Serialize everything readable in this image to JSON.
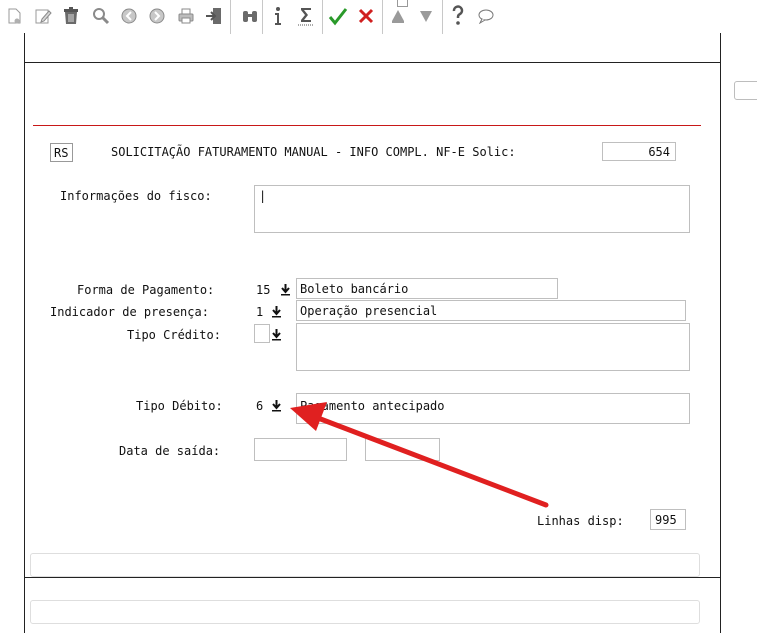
{
  "toolbar": {
    "icons": [
      "new-icon",
      "edit-icon",
      "delete-icon",
      "search-icon",
      "previous-icon",
      "next-icon",
      "print-icon",
      "exit-icon",
      "binoculars-icon",
      "info-icon",
      "sum-icon",
      "confirm-icon",
      "cancel-icon",
      "up-icon",
      "down-icon",
      "help-icon",
      "chat-icon"
    ],
    "colors": {
      "confirm": "#2a9a2a",
      "cancel": "#d02020",
      "gray": "#8a8a8a"
    }
  },
  "header": {
    "rs": "RS",
    "title": "SOLICITAÇÃO FATURAMENTO MANUAL - INFO COMPL. NF-E Solic:",
    "solic": "654"
  },
  "form": {
    "fisco_label": "Informações do fisco:",
    "fisco_value": "|",
    "pagamento_label": "Forma de Pagamento:",
    "pagamento_code": "15",
    "pagamento_desc": "Boleto bancário",
    "presenca_label": "Indicador de presença:",
    "presenca_code": "1",
    "presenca_desc": "Operação presencial",
    "credito_label": "Tipo Crédito:",
    "credito_code": "",
    "credito_desc": "",
    "debito_label": "Tipo Débito:",
    "debito_code": "6",
    "debito_desc": "Pagamento antecipado",
    "saida_label": "Data de saída:",
    "saida_date": "",
    "saida_time": "",
    "linhas_label": "Linhas disp:",
    "linhas_value": "995"
  },
  "annotation": {
    "arrow_color": "#e02020"
  }
}
